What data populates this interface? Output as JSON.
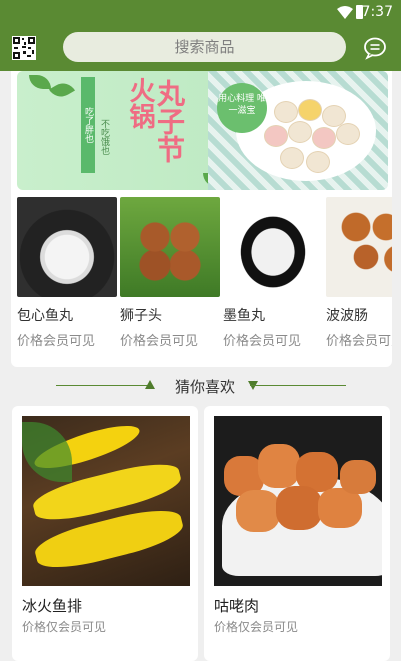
{
  "status_bar": {
    "time": "7:37"
  },
  "header": {
    "search_placeholder": "搜索商品"
  },
  "banner": {
    "title_1": "火锅",
    "title_2": "丸子节",
    "side_text_1": "吃了胖也",
    "side_text_2": "不吃饿也",
    "badge_text": "用心料理 唯一滋宝"
  },
  "products": [
    {
      "name": "包心鱼丸",
      "price": "价格会员可见"
    },
    {
      "name": "狮子头",
      "price": "价格会员可见"
    },
    {
      "name": "墨鱼丸",
      "price": "价格会员可见"
    },
    {
      "name": "波波肠",
      "price": "价格会员可见"
    }
  ],
  "recommend": {
    "title": "猜你喜欢"
  },
  "guess_items": [
    {
      "name": "冰火鱼排",
      "price": "价格仅会员可见"
    },
    {
      "name": "咕咾肉",
      "price": "价格仅会员可见"
    }
  ],
  "colors": {
    "brand_green": "#5a8a33",
    "banner_green": "#c9efcc",
    "pink_text": "#ef6c83"
  }
}
